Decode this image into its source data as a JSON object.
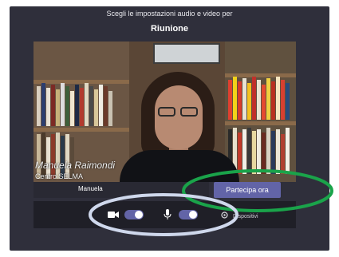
{
  "prejoin": {
    "heading": "Scegli le impostazioni audio e video per",
    "meeting_title": "Riunione"
  },
  "video": {
    "caption_name": "Manuela Raimondi",
    "caption_org": "Centro SELMA"
  },
  "name_field": {
    "value": "Manuela"
  },
  "join_button_label": "Partecipa ora",
  "controls": {
    "camera_on": true,
    "microphone_on": true,
    "devices_label": "Dispositivi"
  },
  "colors": {
    "background": "#2f2f3b",
    "accent": "#6264a7",
    "annotation_green": "#1aa34a",
    "annotation_blue": "#cfd8ec"
  },
  "icons": [
    "camera-icon",
    "microphone-icon",
    "gear-icon"
  ]
}
